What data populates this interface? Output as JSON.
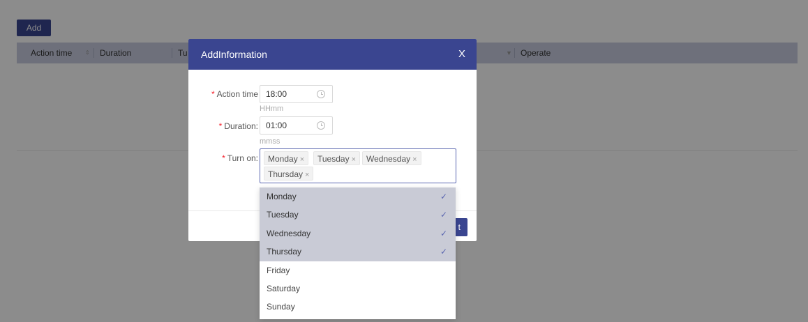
{
  "toolbar": {
    "add_label": "Add"
  },
  "table": {
    "columns": [
      "Action time",
      "Duration",
      "Tu",
      "Operate"
    ],
    "sort_icon": "sort-icon",
    "filter_icon": "filter-icon"
  },
  "modal": {
    "title": "AddInformation",
    "close_symbol": "X",
    "fields": {
      "action_time": {
        "label": "Action time",
        "value": "18:00",
        "hint": "HHmm"
      },
      "duration": {
        "label": "Duration:",
        "value": "01:00",
        "hint": "mmss"
      },
      "turn_on": {
        "label": "Turn on:",
        "tags": [
          "Monday",
          "Tuesday",
          "Wednesday",
          "Thursday"
        ],
        "remove_symbol": "×"
      }
    },
    "required_marker": "*",
    "ok_label": "t"
  },
  "dropdown": {
    "options": [
      {
        "label": "Monday",
        "selected": true
      },
      {
        "label": "Tuesday",
        "selected": true
      },
      {
        "label": "Wednesday",
        "selected": true
      },
      {
        "label": "Thursday",
        "selected": true
      },
      {
        "label": "Friday",
        "selected": false
      },
      {
        "label": "Saturday",
        "selected": false
      },
      {
        "label": "Sunday",
        "selected": false
      }
    ],
    "check_symbol": "✓"
  },
  "colors": {
    "primary": "#3a4590",
    "header_bg": "#c8cde0",
    "selected_bg": "#c9cbd6",
    "required": "#f5222d"
  }
}
